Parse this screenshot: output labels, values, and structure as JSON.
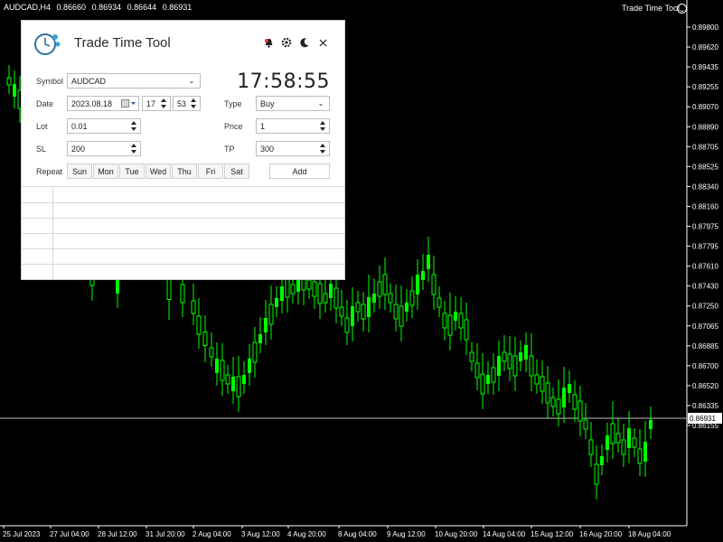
{
  "chart": {
    "symbol_tf": "AUDCAD,H4",
    "ohlc": [
      "0.86660",
      "0.86934",
      "0.86644",
      "0.86931"
    ],
    "indicator_label": "Trade Time Tool",
    "current_price": "0.86931",
    "price_labels": [
      "0.89800",
      "0.89620",
      "0.89435",
      "0.89255",
      "0.89070",
      "0.88890",
      "0.88705",
      "0.88525",
      "0.88340",
      "0.88160",
      "0.87975",
      "0.87795",
      "0.87610",
      "0.87430",
      "0.87250",
      "0.87065",
      "0.86885",
      "0.86700",
      "0.86520",
      "0.86335",
      "0.86155"
    ],
    "time_labels": [
      "25 Jul 2023",
      "27 Jul 04:00",
      "28 Jul 12:00",
      "31 Jul 20:00",
      "2 Aug 04:00",
      "3 Aug 12:00",
      "4 Aug 20:00",
      "8 Aug 04:00",
      "9 Aug 12:00",
      "10 Aug 20:00",
      "14 Aug 04:00",
      "15 Aug 12:00",
      "16 Aug 20:00",
      "18 Aug 04:00"
    ],
    "colors": {
      "background": "#000000",
      "candle": "#00ff00",
      "text": "#ffffff",
      "price_line": "#c0c0c0"
    }
  },
  "panel": {
    "title": "Trade Time Tool",
    "icons": [
      "bell-icon",
      "gear-icon",
      "moon-icon",
      "close-icon"
    ],
    "clock": "17:58:55",
    "symbol_label": "Symbol",
    "symbol_value": "AUDCAD",
    "date_label": "Date",
    "date_value": "2023.08.18",
    "hour_value": "17",
    "minute_value": "53",
    "type_label": "Type",
    "type_value": "Buy",
    "lot_label": "Lot",
    "lot_value": "0.01",
    "price_label": "Price",
    "price_value": "1",
    "sl_label": "SL",
    "sl_value": "200",
    "tp_label": "TP",
    "tp_value": "300",
    "repeat_label": "Repeat",
    "days": [
      "Sun",
      "Mon",
      "Tue",
      "Wed",
      "Thu",
      "Fri",
      "Sat"
    ],
    "add_label": "Add"
  }
}
